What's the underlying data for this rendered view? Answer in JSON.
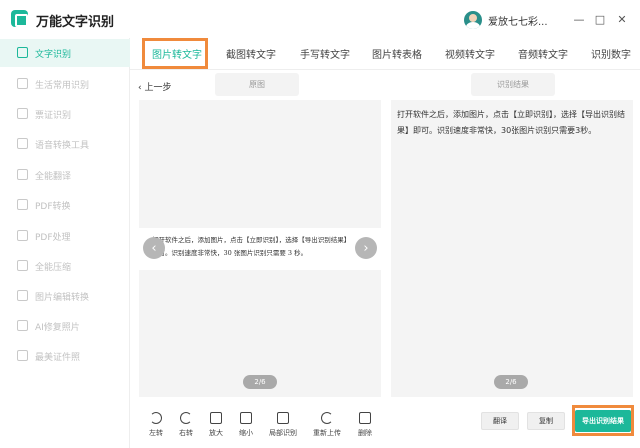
{
  "app": {
    "title": "万能文字识别",
    "user_name": "爱放七七彩..."
  },
  "window": {
    "minimize_glyph": "—",
    "maximize_glyph": "□",
    "close_glyph": "✕"
  },
  "sidebar": {
    "items": [
      {
        "label": "文字识别",
        "active": true,
        "icon": "text-recognition-icon"
      },
      {
        "label": "生活常用识别",
        "icon": "life-icon"
      },
      {
        "label": "票证识别",
        "icon": "ticket-icon"
      },
      {
        "label": "语音转换工具",
        "icon": "voice-icon"
      },
      {
        "label": "全能翻译",
        "icon": "translate-icon"
      },
      {
        "label": "PDF转换",
        "icon": "pdf-convert-icon"
      },
      {
        "label": "PDF处理",
        "icon": "pdf-process-icon"
      },
      {
        "label": "全能压缩",
        "icon": "compress-icon"
      },
      {
        "label": "图片编辑转换",
        "icon": "image-edit-icon"
      },
      {
        "label": "AI修复照片",
        "icon": "ai-photo-icon"
      },
      {
        "label": "最美证件照",
        "icon": "id-photo-icon"
      }
    ]
  },
  "tabs": [
    {
      "label": "图片转文字",
      "active": true
    },
    {
      "label": "截图转文字"
    },
    {
      "label": "手写转文字"
    },
    {
      "label": "图片转表格"
    },
    {
      "label": "视频转文字"
    },
    {
      "label": "音频转文字"
    },
    {
      "label": "识别数字"
    }
  ],
  "subheader": {
    "back": "上一步",
    "original_tab": "原图",
    "result_tab": "识别结果"
  },
  "document": {
    "line1": "打开软件之后，添加图片，点击【立即识别】，选择【导出识别结果】",
    "line2": "即可。识别速度非常快，30 张图片识别只需要 3 秒。",
    "page": "2/6"
  },
  "result": {
    "text": "打开软件之后，添加图片，点击【立即识别】，选择【导出识别结果】即可。识别速度非常快，30张图片识别只需要3秒。",
    "page": "2/6"
  },
  "toolbar": {
    "tools": [
      {
        "label": "左转",
        "icon": "rotate-left-icon"
      },
      {
        "label": "右转",
        "icon": "rotate-right-icon"
      },
      {
        "label": "放大",
        "icon": "zoom-in-icon"
      },
      {
        "label": "缩小",
        "icon": "zoom-out-icon"
      },
      {
        "label": "局部识别",
        "icon": "partial-recognize-icon"
      },
      {
        "label": "重新上传",
        "icon": "reupload-icon"
      },
      {
        "label": "删除",
        "icon": "delete-icon"
      }
    ],
    "translate": "翻译",
    "copy": "复制",
    "export": "导出识别结果"
  },
  "colors": {
    "accent": "#1cb89a",
    "highlight": "#f08a3c"
  }
}
